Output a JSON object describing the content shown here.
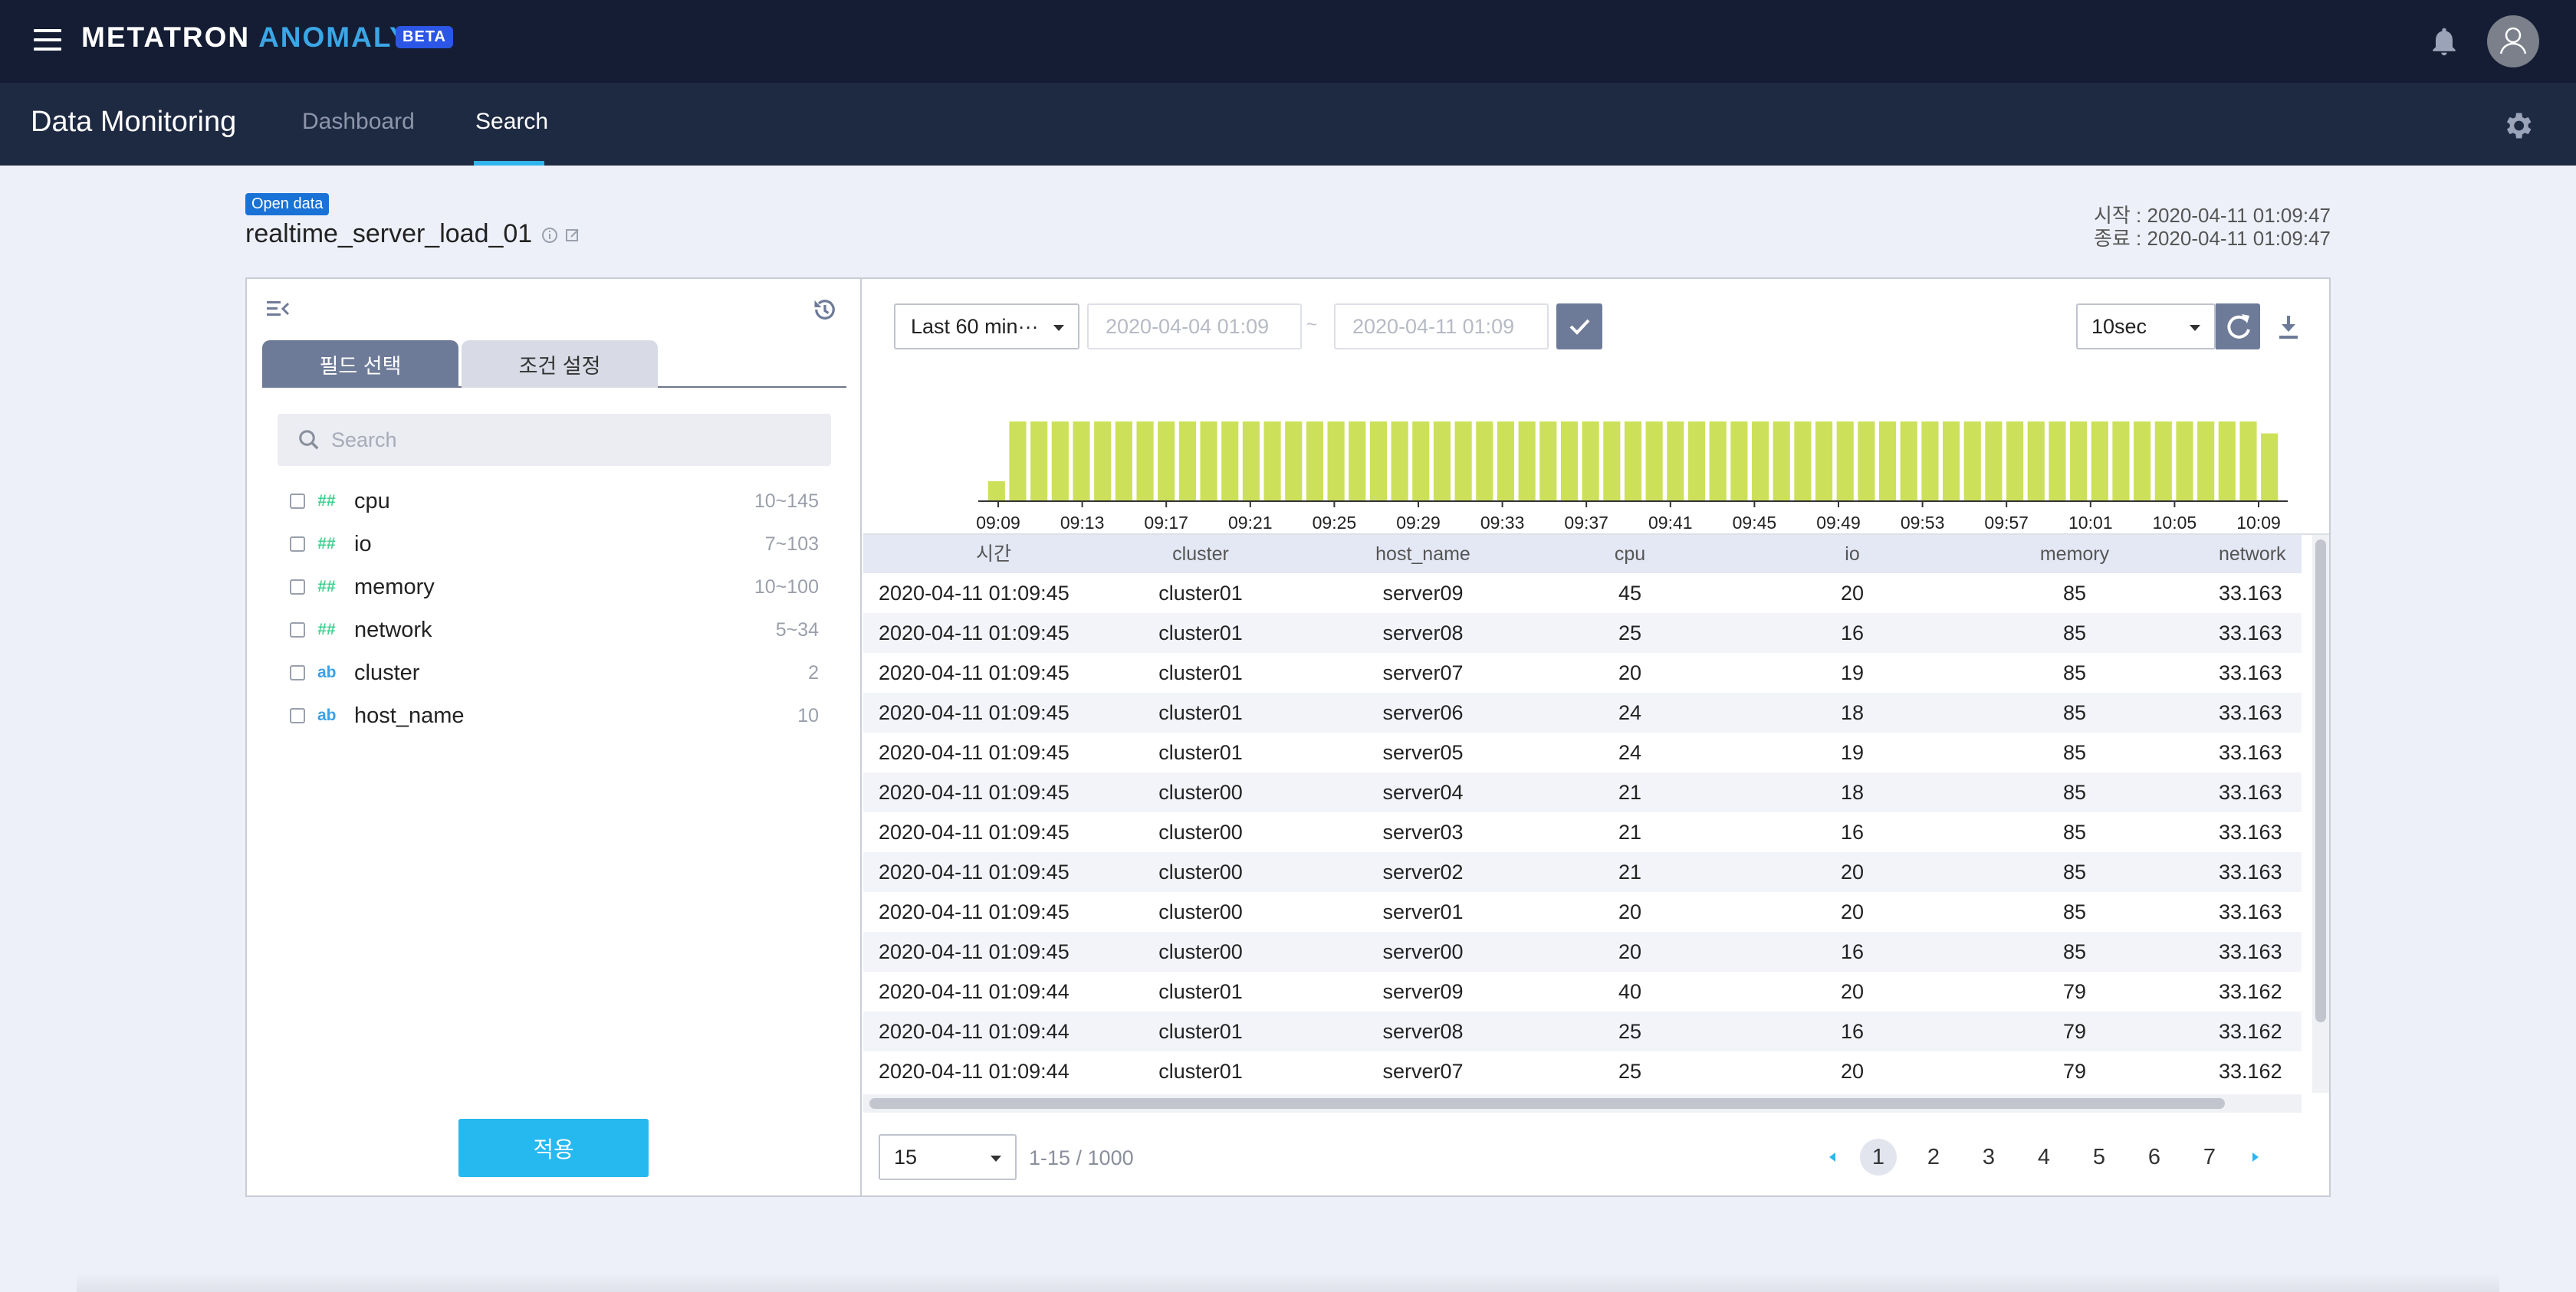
{
  "app": {
    "brand_part1": "METATRON ",
    "brand_part2": "ANOMALY",
    "beta": "BETA"
  },
  "nav": {
    "title": "Data Monitoring",
    "tabs": [
      "Dashboard",
      "Search"
    ],
    "active_tab": "Search"
  },
  "dataset": {
    "badge": "Open data",
    "name": "realtime_server_load_01",
    "start": "시작 : 2020-04-11 01:09:47",
    "end": "종료 : 2020-04-11 01:09:47"
  },
  "left_panel": {
    "tabs": [
      "필드 선택",
      "조건 설정"
    ],
    "search_placeholder": "Search",
    "fields": [
      {
        "type_icon": "##",
        "type": "number",
        "name": "cpu",
        "range": "10~145"
      },
      {
        "type_icon": "##",
        "type": "number",
        "name": "io",
        "range": "7~103"
      },
      {
        "type_icon": "##",
        "type": "number",
        "name": "memory",
        "range": "10~100"
      },
      {
        "type_icon": "##",
        "type": "number",
        "name": "network",
        "range": "5~34"
      },
      {
        "type_icon": "ab",
        "type": "string",
        "name": "cluster",
        "range": "2"
      },
      {
        "type_icon": "ab",
        "type": "string",
        "name": "host_name",
        "range": "10"
      }
    ],
    "apply": "적용"
  },
  "toolbar": {
    "range": "Last 60 min···",
    "date_from": "2020-04-04 01:09",
    "date_sep": "~",
    "date_to": "2020-04-11 01:09",
    "interval": "10sec"
  },
  "chart_data": {
    "type": "bar",
    "title": "",
    "xlabel": "",
    "ylabel": "",
    "x_tick_labels": [
      "09:09",
      "09:13",
      "09:17",
      "09:21",
      "09:25",
      "09:29",
      "09:33",
      "09:37",
      "09:41",
      "09:45",
      "09:49",
      "09:53",
      "09:57",
      "10:01",
      "10:05",
      "10:09"
    ],
    "values": [
      0.25,
      1,
      1,
      1,
      1,
      1,
      1,
      1,
      1,
      1,
      1,
      1,
      1,
      1,
      1,
      1,
      1,
      1,
      1,
      1,
      1,
      1,
      1,
      1,
      1,
      1,
      1,
      1,
      1,
      1,
      1,
      1,
      1,
      1,
      1,
      1,
      1,
      1,
      1,
      1,
      1,
      1,
      1,
      1,
      1,
      1,
      1,
      1,
      1,
      1,
      1,
      1,
      1,
      1,
      1,
      1,
      1,
      1,
      1,
      1,
      0.85
    ],
    "bar_color": "#cde05a",
    "grid": false
  },
  "table": {
    "columns": [
      "시간",
      "cluster",
      "host_name",
      "cpu",
      "io",
      "memory",
      "network"
    ],
    "rows": [
      [
        "2020-04-11 01:09:45",
        "cluster01",
        "server09",
        "45",
        "20",
        "85",
        "33.163"
      ],
      [
        "2020-04-11 01:09:45",
        "cluster01",
        "server08",
        "25",
        "16",
        "85",
        "33.163"
      ],
      [
        "2020-04-11 01:09:45",
        "cluster01",
        "server07",
        "20",
        "19",
        "85",
        "33.163"
      ],
      [
        "2020-04-11 01:09:45",
        "cluster01",
        "server06",
        "24",
        "18",
        "85",
        "33.163"
      ],
      [
        "2020-04-11 01:09:45",
        "cluster01",
        "server05",
        "24",
        "19",
        "85",
        "33.163"
      ],
      [
        "2020-04-11 01:09:45",
        "cluster00",
        "server04",
        "21",
        "18",
        "85",
        "33.163"
      ],
      [
        "2020-04-11 01:09:45",
        "cluster00",
        "server03",
        "21",
        "16",
        "85",
        "33.163"
      ],
      [
        "2020-04-11 01:09:45",
        "cluster00",
        "server02",
        "21",
        "20",
        "85",
        "33.163"
      ],
      [
        "2020-04-11 01:09:45",
        "cluster00",
        "server01",
        "20",
        "20",
        "85",
        "33.163"
      ],
      [
        "2020-04-11 01:09:45",
        "cluster00",
        "server00",
        "20",
        "16",
        "85",
        "33.163"
      ],
      [
        "2020-04-11 01:09:44",
        "cluster01",
        "server09",
        "40",
        "20",
        "79",
        "33.162"
      ],
      [
        "2020-04-11 01:09:44",
        "cluster01",
        "server08",
        "25",
        "16",
        "79",
        "33.162"
      ],
      [
        "2020-04-11 01:09:44",
        "cluster01",
        "server07",
        "25",
        "20",
        "79",
        "33.162"
      ]
    ]
  },
  "pagination": {
    "page_size": "15",
    "summary": "1-15 / 1000",
    "pages": [
      "1",
      "2",
      "3",
      "4",
      "5",
      "6",
      "7"
    ],
    "current": "1"
  },
  "colors": {
    "topbar": "#141d33",
    "navbar": "#1e2942",
    "accent": "#2fb5ee",
    "bar": "#cde05a"
  }
}
